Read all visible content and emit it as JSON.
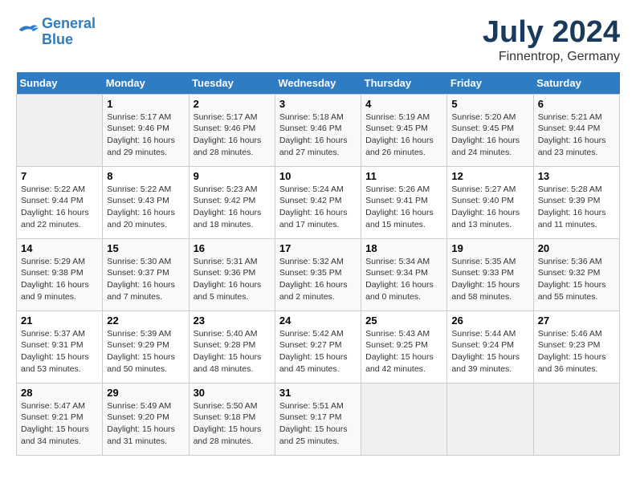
{
  "header": {
    "logo_line1": "General",
    "logo_line2": "Blue",
    "month": "July 2024",
    "location": "Finnentrop, Germany"
  },
  "weekdays": [
    "Sunday",
    "Monday",
    "Tuesday",
    "Wednesday",
    "Thursday",
    "Friday",
    "Saturday"
  ],
  "weeks": [
    [
      {
        "day": "",
        "info": ""
      },
      {
        "day": "1",
        "info": "Sunrise: 5:17 AM\nSunset: 9:46 PM\nDaylight: 16 hours\nand 29 minutes."
      },
      {
        "day": "2",
        "info": "Sunrise: 5:17 AM\nSunset: 9:46 PM\nDaylight: 16 hours\nand 28 minutes."
      },
      {
        "day": "3",
        "info": "Sunrise: 5:18 AM\nSunset: 9:46 PM\nDaylight: 16 hours\nand 27 minutes."
      },
      {
        "day": "4",
        "info": "Sunrise: 5:19 AM\nSunset: 9:45 PM\nDaylight: 16 hours\nand 26 minutes."
      },
      {
        "day": "5",
        "info": "Sunrise: 5:20 AM\nSunset: 9:45 PM\nDaylight: 16 hours\nand 24 minutes."
      },
      {
        "day": "6",
        "info": "Sunrise: 5:21 AM\nSunset: 9:44 PM\nDaylight: 16 hours\nand 23 minutes."
      }
    ],
    [
      {
        "day": "7",
        "info": "Sunrise: 5:22 AM\nSunset: 9:44 PM\nDaylight: 16 hours\nand 22 minutes."
      },
      {
        "day": "8",
        "info": "Sunrise: 5:22 AM\nSunset: 9:43 PM\nDaylight: 16 hours\nand 20 minutes."
      },
      {
        "day": "9",
        "info": "Sunrise: 5:23 AM\nSunset: 9:42 PM\nDaylight: 16 hours\nand 18 minutes."
      },
      {
        "day": "10",
        "info": "Sunrise: 5:24 AM\nSunset: 9:42 PM\nDaylight: 16 hours\nand 17 minutes."
      },
      {
        "day": "11",
        "info": "Sunrise: 5:26 AM\nSunset: 9:41 PM\nDaylight: 16 hours\nand 15 minutes."
      },
      {
        "day": "12",
        "info": "Sunrise: 5:27 AM\nSunset: 9:40 PM\nDaylight: 16 hours\nand 13 minutes."
      },
      {
        "day": "13",
        "info": "Sunrise: 5:28 AM\nSunset: 9:39 PM\nDaylight: 16 hours\nand 11 minutes."
      }
    ],
    [
      {
        "day": "14",
        "info": "Sunrise: 5:29 AM\nSunset: 9:38 PM\nDaylight: 16 hours\nand 9 minutes."
      },
      {
        "day": "15",
        "info": "Sunrise: 5:30 AM\nSunset: 9:37 PM\nDaylight: 16 hours\nand 7 minutes."
      },
      {
        "day": "16",
        "info": "Sunrise: 5:31 AM\nSunset: 9:36 PM\nDaylight: 16 hours\nand 5 minutes."
      },
      {
        "day": "17",
        "info": "Sunrise: 5:32 AM\nSunset: 9:35 PM\nDaylight: 16 hours\nand 2 minutes."
      },
      {
        "day": "18",
        "info": "Sunrise: 5:34 AM\nSunset: 9:34 PM\nDaylight: 16 hours\nand 0 minutes."
      },
      {
        "day": "19",
        "info": "Sunrise: 5:35 AM\nSunset: 9:33 PM\nDaylight: 15 hours\nand 58 minutes."
      },
      {
        "day": "20",
        "info": "Sunrise: 5:36 AM\nSunset: 9:32 PM\nDaylight: 15 hours\nand 55 minutes."
      }
    ],
    [
      {
        "day": "21",
        "info": "Sunrise: 5:37 AM\nSunset: 9:31 PM\nDaylight: 15 hours\nand 53 minutes."
      },
      {
        "day": "22",
        "info": "Sunrise: 5:39 AM\nSunset: 9:29 PM\nDaylight: 15 hours\nand 50 minutes."
      },
      {
        "day": "23",
        "info": "Sunrise: 5:40 AM\nSunset: 9:28 PM\nDaylight: 15 hours\nand 48 minutes."
      },
      {
        "day": "24",
        "info": "Sunrise: 5:42 AM\nSunset: 9:27 PM\nDaylight: 15 hours\nand 45 minutes."
      },
      {
        "day": "25",
        "info": "Sunrise: 5:43 AM\nSunset: 9:25 PM\nDaylight: 15 hours\nand 42 minutes."
      },
      {
        "day": "26",
        "info": "Sunrise: 5:44 AM\nSunset: 9:24 PM\nDaylight: 15 hours\nand 39 minutes."
      },
      {
        "day": "27",
        "info": "Sunrise: 5:46 AM\nSunset: 9:23 PM\nDaylight: 15 hours\nand 36 minutes."
      }
    ],
    [
      {
        "day": "28",
        "info": "Sunrise: 5:47 AM\nSunset: 9:21 PM\nDaylight: 15 hours\nand 34 minutes."
      },
      {
        "day": "29",
        "info": "Sunrise: 5:49 AM\nSunset: 9:20 PM\nDaylight: 15 hours\nand 31 minutes."
      },
      {
        "day": "30",
        "info": "Sunrise: 5:50 AM\nSunset: 9:18 PM\nDaylight: 15 hours\nand 28 minutes."
      },
      {
        "day": "31",
        "info": "Sunrise: 5:51 AM\nSunset: 9:17 PM\nDaylight: 15 hours\nand 25 minutes."
      },
      {
        "day": "",
        "info": ""
      },
      {
        "day": "",
        "info": ""
      },
      {
        "day": "",
        "info": ""
      }
    ]
  ]
}
